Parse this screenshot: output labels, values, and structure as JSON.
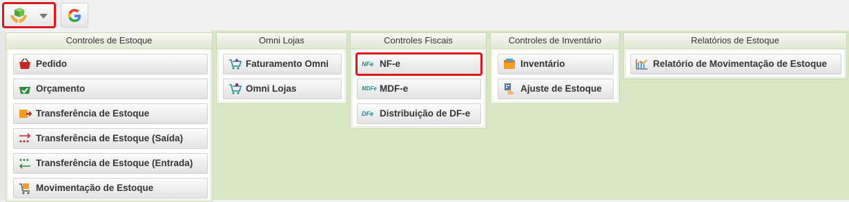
{
  "toolbar": {
    "apps_button": {
      "icon": "apps-hands-box-icon"
    },
    "refresh_button": {
      "icon": "google-g-icon"
    }
  },
  "groups": [
    {
      "title": "Controles de Estoque",
      "items": [
        {
          "label": "Pedido",
          "icon": "basket-icon"
        },
        {
          "label": "Orçamento",
          "icon": "basket-check-icon"
        },
        {
          "label": "Transferência de Estoque",
          "icon": "box-arrow-icon"
        },
        {
          "label": "Transferência de Estoque (Saída)",
          "icon": "arrow-out-icon"
        },
        {
          "label": "Transferência de Estoque (Entrada)",
          "icon": "arrow-in-icon"
        },
        {
          "label": "Movimentação de Estoque",
          "icon": "cart-box-icon"
        }
      ]
    },
    {
      "title": "Omni Lojas",
      "items": [
        {
          "label": "Faturamento Omni",
          "icon": "cart-plus-icon"
        },
        {
          "label": "Omni Lojas",
          "icon": "cart-icon"
        }
      ]
    },
    {
      "title": "Controles Fiscais",
      "items": [
        {
          "label": "NF-e",
          "icon": "nfe-icon",
          "icon_text": "NFe"
        },
        {
          "label": "MDF-e",
          "icon": "mdfe-icon",
          "icon_text": "MDFe"
        },
        {
          "label": "Distribuição de DF-e",
          "icon": "dfe-icon",
          "icon_text": "DFe"
        }
      ]
    },
    {
      "title": "Controles de Inventário",
      "items": [
        {
          "label": "Inventário",
          "icon": "inventory-box-icon"
        },
        {
          "label": "Ajuste de Estoque",
          "icon": "hand-building-icon"
        }
      ]
    },
    {
      "title": "Relatórios de Estoque",
      "items": [
        {
          "label": "Relatório de Movimentação de Estoque",
          "icon": "chart-report-icon"
        }
      ]
    }
  ]
}
